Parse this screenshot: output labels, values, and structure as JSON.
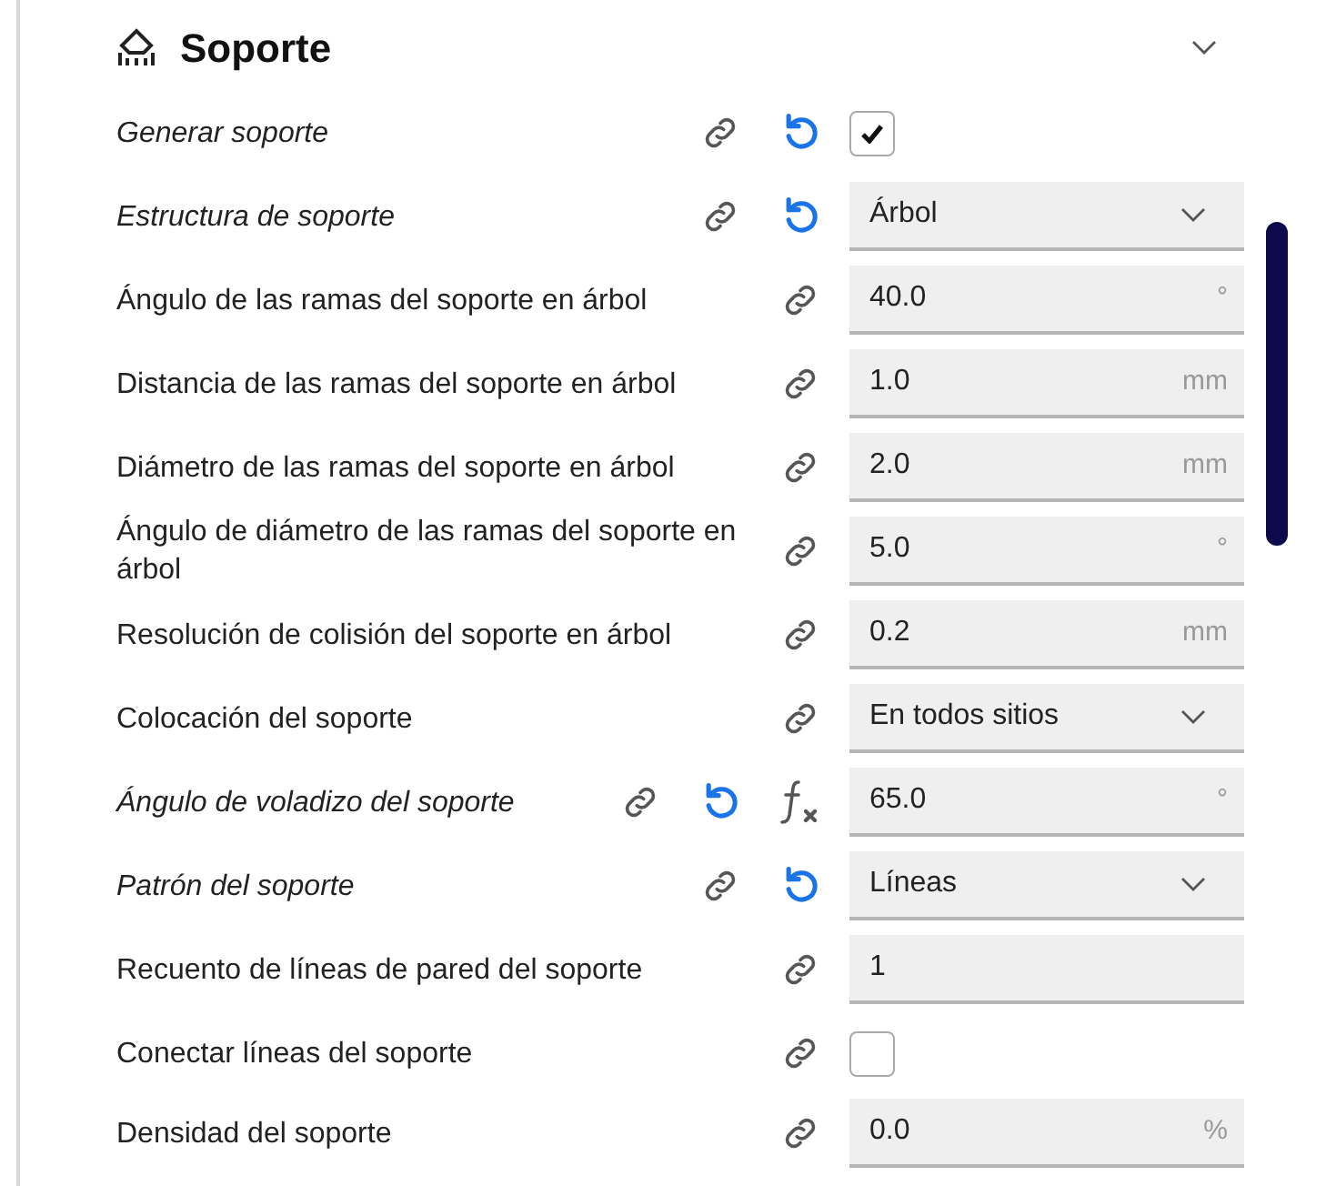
{
  "section": {
    "title": "Soporte",
    "expanded": true
  },
  "settings": [
    {
      "label": "Generar soporte",
      "modified": true,
      "formula": false,
      "kind": "checkbox",
      "checked": true
    },
    {
      "label": "Estructura de soporte",
      "modified": true,
      "formula": false,
      "kind": "dropdown",
      "value": "Árbol"
    },
    {
      "label": "Ángulo de las ramas del soporte en árbol",
      "modified": false,
      "formula": false,
      "kind": "number",
      "value": "40.0",
      "unit": "°"
    },
    {
      "label": "Distancia de las ramas del soporte en árbol",
      "modified": false,
      "formula": false,
      "kind": "number",
      "value": "1.0",
      "unit": "mm"
    },
    {
      "label": "Diámetro de las ramas del soporte en árbol",
      "modified": false,
      "formula": false,
      "kind": "number",
      "value": "2.0",
      "unit": "mm"
    },
    {
      "label": "Ángulo de diámetro de las ramas del soporte en árbol",
      "modified": false,
      "formula": false,
      "kind": "number",
      "value": "5.0",
      "unit": "°"
    },
    {
      "label": "Resolución de colisión del soporte en árbol",
      "modified": false,
      "formula": false,
      "kind": "number",
      "value": "0.2",
      "unit": "mm"
    },
    {
      "label": "Colocación del soporte",
      "modified": false,
      "formula": false,
      "kind": "dropdown",
      "value": "En todos sitios"
    },
    {
      "label": "Ángulo de voladizo del soporte",
      "modified": true,
      "formula": true,
      "kind": "number",
      "value": "65.0",
      "unit": "°"
    },
    {
      "label": "Patrón del soporte",
      "modified": true,
      "formula": false,
      "kind": "dropdown",
      "value": "Líneas"
    },
    {
      "label": "Recuento de líneas de pared del soporte",
      "modified": false,
      "formula": false,
      "kind": "number",
      "value": "1"
    },
    {
      "label": "Conectar líneas del soporte",
      "modified": false,
      "formula": false,
      "kind": "checkbox",
      "checked": false
    },
    {
      "label": "Densidad del soporte",
      "modified": false,
      "formula": false,
      "kind": "number",
      "value": "0.0",
      "unit": "%"
    }
  ]
}
